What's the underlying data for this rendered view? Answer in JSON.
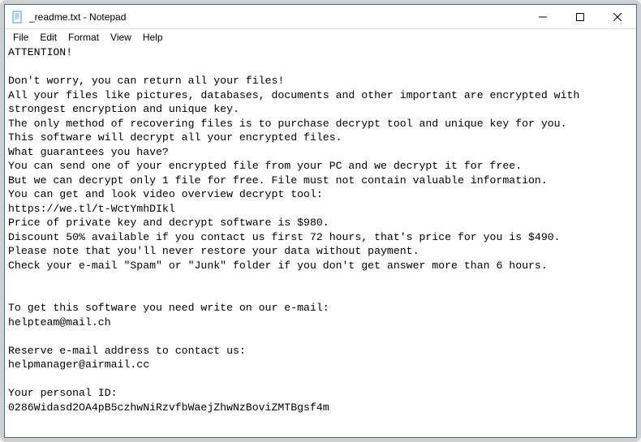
{
  "window": {
    "title": "_readme.txt - Notepad"
  },
  "menu": {
    "file": "File",
    "edit": "Edit",
    "format": "Format",
    "view": "View",
    "help": "Help"
  },
  "content": {
    "text": "ATTENTION!\n\nDon't worry, you can return all your files!\nAll your files like pictures, databases, documents and other important are encrypted with strongest encryption and unique key.\nThe only method of recovering files is to purchase decrypt tool and unique key for you.\nThis software will decrypt all your encrypted files.\nWhat guarantees you have?\nYou can send one of your encrypted file from your PC and we decrypt it for free.\nBut we can decrypt only 1 file for free. File must not contain valuable information.\nYou can get and look video overview decrypt tool:\nhttps://we.tl/t-WctYmhDIkl\nPrice of private key and decrypt software is $980.\nDiscount 50% available if you contact us first 72 hours, that's price for you is $490.\nPlease note that you'll never restore your data without payment.\nCheck your e-mail \"Spam\" or \"Junk\" folder if you don't get answer more than 6 hours.\n\n\nTo get this software you need write on our e-mail:\nhelpteam@mail.ch\n\nReserve e-mail address to contact us:\nhelpmanager@airmail.cc\n\nYour personal ID:\n0286Widasd2OA4pB5czhwNiRzvfbWaejZhwNzBoviZMTBgsf4m"
  }
}
